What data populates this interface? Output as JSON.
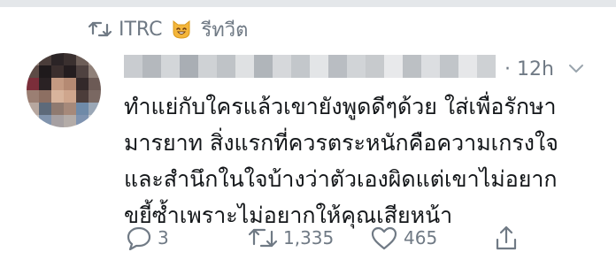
{
  "social_context": {
    "retweeted_by": "ITRC",
    "action_label": "รีทวีต"
  },
  "tweet": {
    "time_label": "· 12h",
    "lines": [
      "ทำแย่กับใครแล้วเขายังพูดดีๆด้วย ใส่เพื่อรักษา",
      "มารยาท สิ่งแรกที่ควรตระหนักคือความเกรงใจ",
      "และสำนึกในใจบ้างว่าตัวเองผิดแต่เขาไม่อยาก",
      "ขยี้ซ้ำเพราะไม่อยากให้คุณเสียหน้า"
    ],
    "reply_count": "3",
    "retweet_count": "1,335",
    "like_count": "465"
  },
  "icons": {
    "retweet": "retweet-icon",
    "emoji": "cat-face-emoji-icon",
    "caret": "chevron-down-icon",
    "reply": "reply-bubble-icon",
    "like": "heart-icon",
    "share": "share-icon"
  },
  "colors": {
    "muted_text": "#707a85",
    "body_text": "#14171a",
    "background": "#ffffff"
  }
}
